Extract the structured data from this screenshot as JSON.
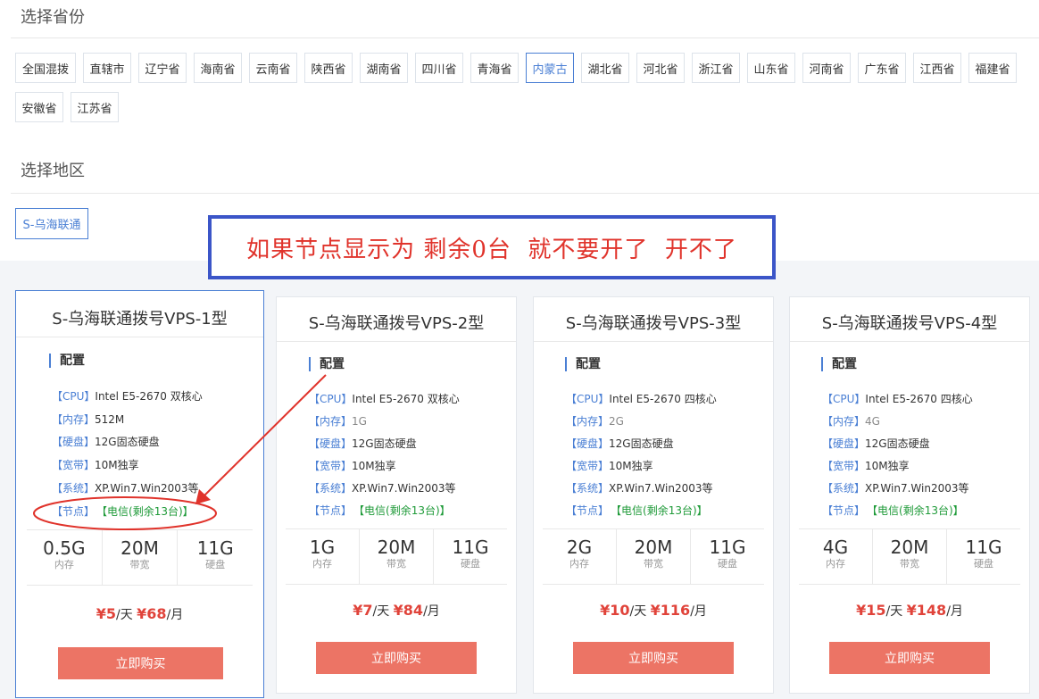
{
  "province_section": {
    "title": "选择省份",
    "items": [
      "全国混拨",
      "直辖市",
      "辽宁省",
      "海南省",
      "云南省",
      "陕西省",
      "湖南省",
      "四川省",
      "青海省",
      "内蒙古",
      "湖北省",
      "河北省",
      "浙江省",
      "山东省",
      "河南省",
      "广东省",
      "江西省",
      "福建省",
      "安徽省",
      "江苏省"
    ],
    "selected": "内蒙古"
  },
  "region_section": {
    "title": "选择地区",
    "selected": "S-乌海联通"
  },
  "notice": "如果节点显示为 剩余0台  就不要开了  开不了",
  "colors": {
    "accent": "#4a7fd4",
    "buy_button": "#ec7465",
    "price": "#e0433a",
    "node_green": "#1e9a38",
    "annotation_red": "#e0332b",
    "notice_border": "#3b55c8"
  },
  "plans": [
    {
      "title": "S-乌海联通拨号VPS-1型",
      "config_label": "配置",
      "specs": [
        {
          "key": "【CPU】",
          "value": "Intel E5-2670 双核心"
        },
        {
          "key": "【内存】",
          "value": "512M"
        },
        {
          "key": "【硬盘】",
          "value": "12G固态硬盘"
        },
        {
          "key": "【宽带】",
          "value": "10M独享"
        },
        {
          "key": "【系统】",
          "value": "XP.Win7.Win2003等"
        },
        {
          "key": "【节点】",
          "value": "【电信(剩余13台)】"
        }
      ],
      "stats": [
        {
          "num": "0.5G",
          "label": "内存"
        },
        {
          "num": "20M",
          "label": "带宽"
        },
        {
          "num": "11G",
          "label": "硬盘"
        }
      ],
      "price_day": "¥5",
      "day_unit": "/天",
      "price_month": "¥68",
      "month_unit": "/月",
      "buy_label": "立即购买"
    },
    {
      "title": "S-乌海联通拨号VPS-2型",
      "config_label": "配置",
      "specs": [
        {
          "key": "【CPU】",
          "value": "Intel E5-2670 双核心"
        },
        {
          "key": "【内存】",
          "value": "1G"
        },
        {
          "key": "【硬盘】",
          "value": "12G固态硬盘"
        },
        {
          "key": "【宽带】",
          "value": "10M独享"
        },
        {
          "key": "【系统】",
          "value": "XP.Win7.Win2003等"
        },
        {
          "key": "【节点】",
          "value": "【电信(剩余13台)】"
        }
      ],
      "stats": [
        {
          "num": "1G",
          "label": "内存"
        },
        {
          "num": "20M",
          "label": "带宽"
        },
        {
          "num": "11G",
          "label": "硬盘"
        }
      ],
      "price_day": "¥7",
      "day_unit": "/天",
      "price_month": "¥84",
      "month_unit": "/月",
      "buy_label": "立即购买"
    },
    {
      "title": "S-乌海联通拨号VPS-3型",
      "config_label": "配置",
      "specs": [
        {
          "key": "【CPU】",
          "value": "Intel E5-2670 四核心"
        },
        {
          "key": "【内存】",
          "value": "2G"
        },
        {
          "key": "【硬盘】",
          "value": "12G固态硬盘"
        },
        {
          "key": "【宽带】",
          "value": "10M独享"
        },
        {
          "key": "【系统】",
          "value": "XP.Win7.Win2003等"
        },
        {
          "key": "【节点】",
          "value": "【电信(剩余13台)】"
        }
      ],
      "stats": [
        {
          "num": "2G",
          "label": "内存"
        },
        {
          "num": "20M",
          "label": "带宽"
        },
        {
          "num": "11G",
          "label": "硬盘"
        }
      ],
      "price_day": "¥10",
      "day_unit": "/天",
      "price_month": "¥116",
      "month_unit": "/月",
      "buy_label": "立即购买"
    },
    {
      "title": "S-乌海联通拨号VPS-4型",
      "config_label": "配置",
      "specs": [
        {
          "key": "【CPU】",
          "value": "Intel E5-2670 四核心"
        },
        {
          "key": "【内存】",
          "value": "4G"
        },
        {
          "key": "【硬盘】",
          "value": "12G固态硬盘"
        },
        {
          "key": "【宽带】",
          "value": "10M独享"
        },
        {
          "key": "【系统】",
          "value": "XP.Win7.Win2003等"
        },
        {
          "key": "【节点】",
          "value": "【电信(剩余13台)】"
        }
      ],
      "stats": [
        {
          "num": "4G",
          "label": "内存"
        },
        {
          "num": "20M",
          "label": "带宽"
        },
        {
          "num": "11G",
          "label": "硬盘"
        }
      ],
      "price_day": "¥15",
      "day_unit": "/天",
      "price_month": "¥148",
      "month_unit": "/月",
      "buy_label": "立即购买"
    }
  ]
}
